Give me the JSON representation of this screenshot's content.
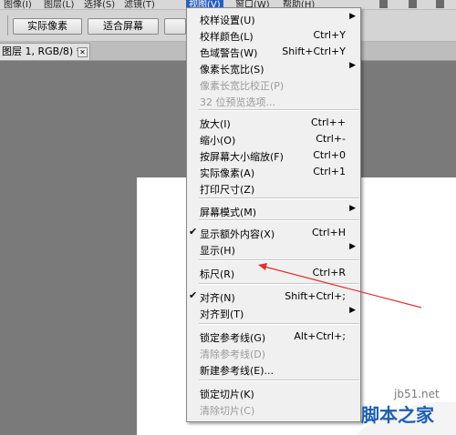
{
  "menubar": {
    "items": [
      "图像(I)",
      "图层(L)",
      "选择(S)",
      "滤镜(T)",
      "视图(V)",
      "窗口(W)",
      "帮助(H)"
    ]
  },
  "options": {
    "actual_pixels": "实际像素",
    "fit_screen": "适合屏幕"
  },
  "doc_tab": {
    "label": "图层 1, RGB/8) *",
    "close": "✕"
  },
  "menu": {
    "items": [
      {
        "label": "校样设置(U)",
        "shortcut": "",
        "submenu": true,
        "disabled": false,
        "checked": false
      },
      {
        "label": "校样颜色(L)",
        "shortcut": "Ctrl+Y",
        "submenu": false,
        "disabled": false,
        "checked": false
      },
      {
        "label": "色域警告(W)",
        "shortcut": "Shift+Ctrl+Y",
        "submenu": false,
        "disabled": false,
        "checked": false
      },
      {
        "label": "像素长宽比(S)",
        "shortcut": "",
        "submenu": true,
        "disabled": false,
        "checked": false
      },
      {
        "label": "像素长宽比校正(P)",
        "shortcut": "",
        "submenu": false,
        "disabled": true,
        "checked": false
      },
      {
        "label": "32 位预览选项...",
        "shortcut": "",
        "submenu": false,
        "disabled": true,
        "checked": false
      },
      {
        "label": "放大(I)",
        "shortcut": "Ctrl++",
        "submenu": false,
        "disabled": false,
        "checked": false
      },
      {
        "label": "缩小(O)",
        "shortcut": "Ctrl+-",
        "submenu": false,
        "disabled": false,
        "checked": false
      },
      {
        "label": "按屏幕大小缩放(F)",
        "shortcut": "Ctrl+0",
        "submenu": false,
        "disabled": false,
        "checked": false
      },
      {
        "label": "实际像素(A)",
        "shortcut": "Ctrl+1",
        "submenu": false,
        "disabled": false,
        "checked": false
      },
      {
        "label": "打印尺寸(Z)",
        "shortcut": "",
        "submenu": false,
        "disabled": false,
        "checked": false
      },
      {
        "label": "屏幕模式(M)",
        "shortcut": "",
        "submenu": true,
        "disabled": false,
        "checked": false
      },
      {
        "label": "显示额外内容(X)",
        "shortcut": "Ctrl+H",
        "submenu": false,
        "disabled": false,
        "checked": true
      },
      {
        "label": "显示(H)",
        "shortcut": "",
        "submenu": true,
        "disabled": false,
        "checked": false
      },
      {
        "label": "标尺(R)",
        "shortcut": "Ctrl+R",
        "submenu": false,
        "disabled": false,
        "checked": false
      },
      {
        "label": "对齐(N)",
        "shortcut": "Shift+Ctrl+;",
        "submenu": false,
        "disabled": false,
        "checked": true
      },
      {
        "label": "对齐到(T)",
        "shortcut": "",
        "submenu": true,
        "disabled": false,
        "checked": false
      },
      {
        "label": "锁定参考线(G)",
        "shortcut": "Alt+Ctrl+;",
        "submenu": false,
        "disabled": false,
        "checked": false
      },
      {
        "label": "清除参考线(D)",
        "shortcut": "",
        "submenu": false,
        "disabled": true,
        "checked": false
      },
      {
        "label": "新建参考线(E)...",
        "shortcut": "",
        "submenu": false,
        "disabled": false,
        "checked": false
      },
      {
        "label": "锁定切片(K)",
        "shortcut": "",
        "submenu": false,
        "disabled": false,
        "checked": false
      },
      {
        "label": "清除切片(C)",
        "shortcut": "",
        "submenu": false,
        "disabled": true,
        "checked": false
      }
    ],
    "arrow_glyph": "▶",
    "check_glyph": "✔"
  },
  "watermark": {
    "site": "jb51.net",
    "name": "脚本之家"
  },
  "colors": {
    "accent": "#2a5fbf",
    "annotation": "#e03030",
    "watermark_blue": "#1e5fb0"
  }
}
